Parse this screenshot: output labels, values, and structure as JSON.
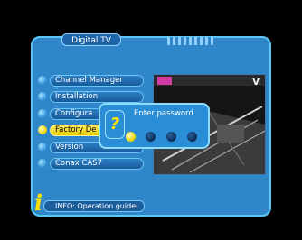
{
  "header": {
    "title": "Digital TV"
  },
  "menu": {
    "items": [
      {
        "label": "Channel Manager",
        "selected": false
      },
      {
        "label": "Installation",
        "selected": false
      },
      {
        "label": "Configura",
        "selected": false
      },
      {
        "label": "Factory De",
        "selected": true
      },
      {
        "label": "Version",
        "selected": false
      },
      {
        "label": "Conax CAS7",
        "selected": false
      }
    ]
  },
  "dialog": {
    "title": "Enter password",
    "icon": "question-mark-icon",
    "symbol": "?",
    "digits_entered": 1,
    "digits_total": 4
  },
  "preview": {
    "logo": "V"
  },
  "info": {
    "symbol": "i",
    "text": "INFO: Operation guidel"
  },
  "colors": {
    "frame": "#2f86c8",
    "highlight": "#f0d000",
    "accent": "#ffe000"
  }
}
